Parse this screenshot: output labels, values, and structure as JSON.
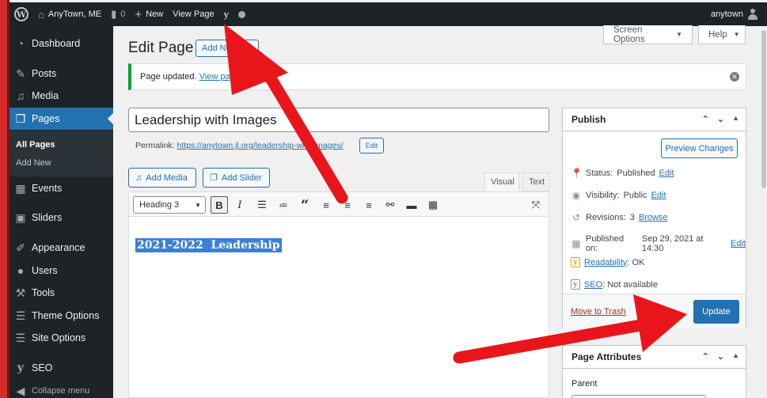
{
  "adminbar": {
    "site_name": "AnyTown, ME",
    "comments_count": "0",
    "new_label": "New",
    "view_page_label": "View Page",
    "username": "anytown"
  },
  "sidebar": {
    "items": [
      {
        "label": "Dashboard",
        "icon": "dashboard-icon"
      },
      {
        "label": "Posts",
        "icon": "pin-icon"
      },
      {
        "label": "Media",
        "icon": "media-icon"
      },
      {
        "label": "Pages",
        "icon": "pages-icon"
      },
      {
        "label": "Events",
        "icon": "calendar-icon"
      },
      {
        "label": "Sliders",
        "icon": "slides-icon"
      },
      {
        "label": "Appearance",
        "icon": "brush-icon"
      },
      {
        "label": "Users",
        "icon": "users-icon"
      },
      {
        "label": "Tools",
        "icon": "wrench-icon"
      },
      {
        "label": "Theme Options",
        "icon": "list-icon"
      },
      {
        "label": "Site Options",
        "icon": "list-icon"
      },
      {
        "label": "SEO",
        "icon": "yoast-icon"
      },
      {
        "label": "Collapse menu",
        "icon": "collapse-icon"
      }
    ],
    "submenu": [
      "All Pages",
      "Add New"
    ]
  },
  "header": {
    "title": "Edit Page",
    "add_new": "Add New",
    "screen_options": "Screen Options",
    "help": "Help"
  },
  "notice": {
    "text": "Page updated.",
    "link": "View page"
  },
  "editor": {
    "post_title": "Leadership with Images",
    "permalink_label": "Permalink:",
    "permalink_url": "https://anytown.jl.org/leadership-with-images/",
    "edit_label": "Edit",
    "add_media": "Add Media",
    "add_slider": "Add Slider",
    "tab_visual": "Visual",
    "tab_text": "Text",
    "format_select": "Heading 3",
    "content_heading": "2021-2022  Leadership"
  },
  "publish": {
    "title": "Publish",
    "preview": "Preview Changes",
    "status_label": "Status:",
    "status_value": "Published",
    "visibility_label": "Visibility:",
    "visibility_value": "Public",
    "revisions_label": "Revisions:",
    "revisions_value": "3",
    "browse": "Browse",
    "published_label": "Published on:",
    "published_value": "Sep 29, 2021 at 14:30",
    "readability_label": "Readability",
    "readability_value": ": OK",
    "seo_label": "SEO",
    "seo_value": ": Not available",
    "edit": "Edit",
    "move_to_trash": "Move to Trash",
    "update": "Update"
  },
  "page_attributes": {
    "title": "Page Attributes",
    "parent_label": "Parent"
  },
  "colors": {
    "accent": "#2271b1",
    "adminbar": "#1d2327",
    "arrow": "#e8161b"
  }
}
